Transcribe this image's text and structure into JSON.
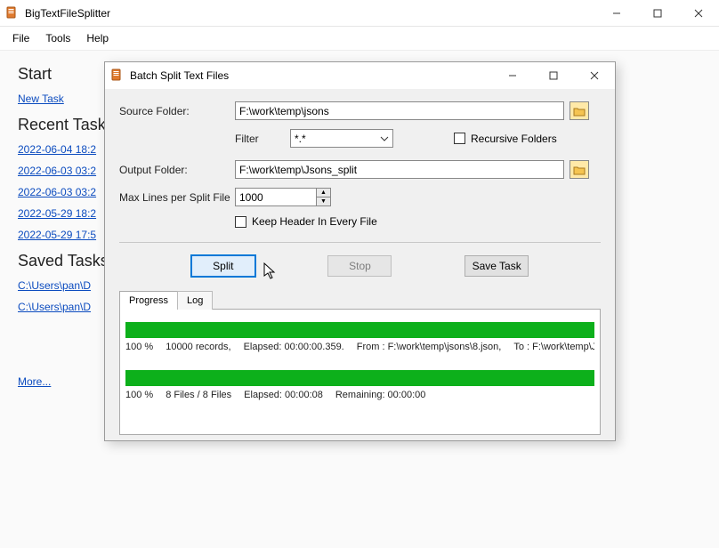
{
  "app": {
    "title": "BigTextFileSplitter"
  },
  "menu": {
    "file": "File",
    "tools": "Tools",
    "help": "Help"
  },
  "sections": {
    "start": "Start",
    "recent": "Recent Tasks",
    "saved": "Saved Tasks"
  },
  "start_links": {
    "new_task": "New Task"
  },
  "recent_items": [
    "2022-06-04 18:2",
    "2022-06-03 03:2",
    "2022-06-03 03:2",
    "2022-05-29 18:2",
    "2022-05-29 17:5"
  ],
  "saved_items": [
    "C:\\Users\\pan\\D",
    "C:\\Users\\pan\\D"
  ],
  "more_link": "More...",
  "dialog": {
    "title": "Batch Split Text Files",
    "source_label": "Source Folder:",
    "source_value": "F:\\work\\temp\\jsons",
    "filter_label": "Filter",
    "filter_value": "*.*",
    "recursive_label": "Recursive Folders",
    "output_label": "Output Folder:",
    "output_value": "F:\\work\\temp\\Jsons_split",
    "maxlines_label": "Max Lines per Split File",
    "maxlines_value": "1000",
    "keep_header_label": "Keep Header In Every File",
    "buttons": {
      "split": "Split",
      "stop": "Stop",
      "save_task": "Save Task"
    },
    "tabs": {
      "progress": "Progress",
      "log": "Log"
    },
    "progress1": {
      "percent": "100 %",
      "records": "10000 records,",
      "elapsed": "Elapsed: 00:00:00.359.",
      "from": "From : F:\\work\\temp\\jsons\\8.json,",
      "to": "To : F:\\work\\temp\\Jsons_spl"
    },
    "progress2": {
      "percent": "100 %",
      "files": "8 Files / 8 Files",
      "elapsed": "Elapsed: 00:00:08",
      "remaining": "Remaining: 00:00:00"
    }
  }
}
